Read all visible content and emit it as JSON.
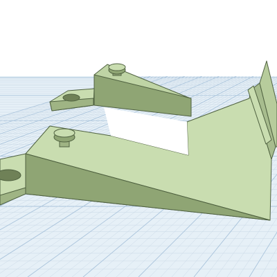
{
  "app": {
    "view": "3d-workplane-viewport"
  },
  "scene": {
    "background_color": "#ffffff",
    "workplane_color": "#e6f0f7",
    "grid_minor_color": "#c9d8e6",
    "grid_major_color": "#a9c3db",
    "model_colors": {
      "top_face": "#c9ddb0",
      "side_face": "#8fa574",
      "dark_face": "#7f9364",
      "edge": "#4f6140"
    },
    "objects": [
      {
        "name": "bracket",
        "type": "3d-model"
      },
      {
        "name": "bolt-head-back",
        "type": "3d-model"
      },
      {
        "name": "bolt-head-front",
        "type": "3d-model"
      }
    ]
  }
}
